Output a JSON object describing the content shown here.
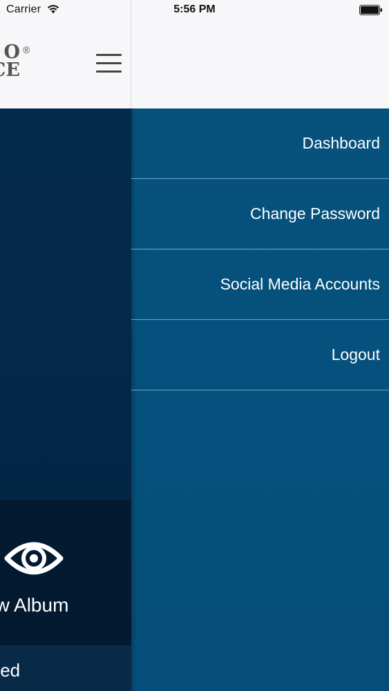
{
  "status_bar": {
    "carrier": "Carrier",
    "time": "5:56 PM"
  },
  "header": {
    "logo_text": "O\nCE",
    "logo_mark": "®"
  },
  "main": {
    "view_album_label": "ew Album",
    "bottom_label": "sted"
  },
  "menu": {
    "items": [
      {
        "label": "Dashboard"
      },
      {
        "label": "Change Password"
      },
      {
        "label": "Social Media Accounts"
      },
      {
        "label": "Logout"
      }
    ]
  },
  "icons": {
    "wifi": "wifi-icon",
    "battery": "battery-icon",
    "menu": "hamburger-menu-icon",
    "view": "eye-icon"
  },
  "colors": {
    "menu_background": "#05507c",
    "main_background": "#032848",
    "tile_background": "#041a31",
    "header_background": "#f7f7f9",
    "divider": "#6fa6c6"
  }
}
